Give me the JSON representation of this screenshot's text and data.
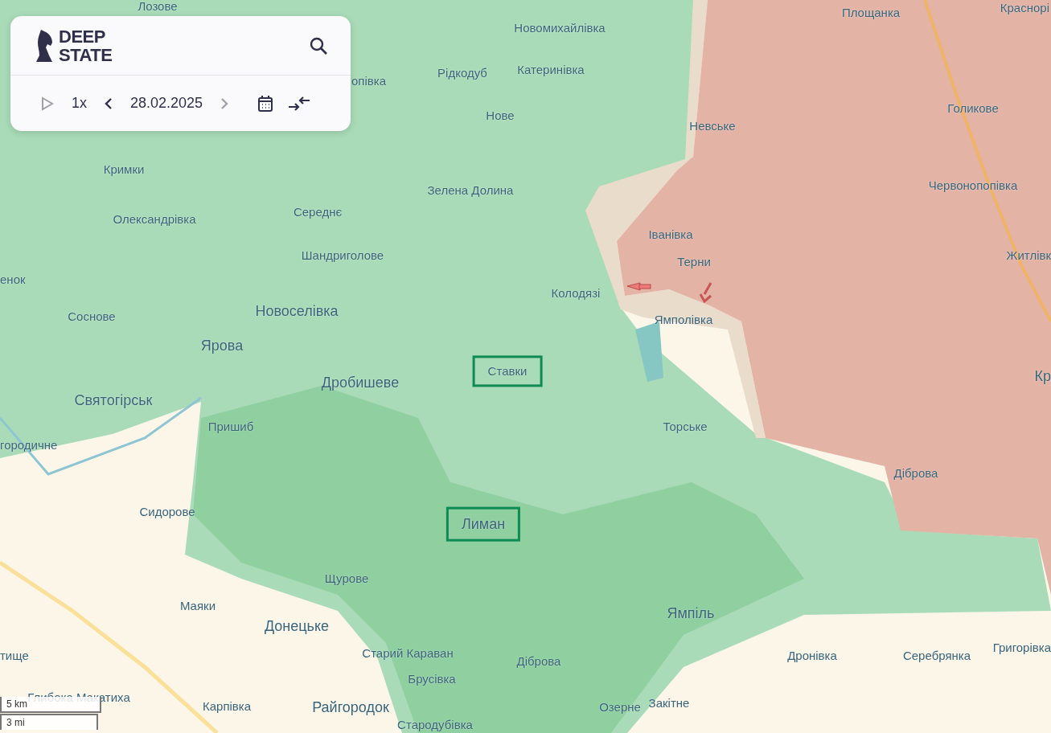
{
  "panel": {
    "logo": [
      "DEEP",
      "STATE"
    ],
    "play": {
      "disabled": true
    },
    "speed": "1x",
    "date": "28.02.2025",
    "prev": {
      "disabled": false
    },
    "next": {
      "disabled": true
    }
  },
  "labels": [
    {
      "text": "Лозове",
      "kind": "village",
      "highlighted": false
    },
    {
      "text": "Новомихайлівка",
      "kind": "village",
      "highlighted": false
    },
    {
      "text": "Площанка",
      "kind": "village",
      "highlighted": false
    },
    {
      "text": "Краснорі",
      "kind": "village",
      "highlighted": false
    },
    {
      "text": "Рідкодуб",
      "kind": "village",
      "highlighted": false
    },
    {
      "text": "Катеринівка",
      "kind": "village",
      "highlighted": false
    },
    {
      "text": "опівка",
      "kind": "village",
      "highlighted": false
    },
    {
      "text": "Нове",
      "kind": "village",
      "highlighted": false
    },
    {
      "text": "Невське",
      "kind": "village",
      "highlighted": false
    },
    {
      "text": "Голикове",
      "kind": "village",
      "highlighted": false
    },
    {
      "text": "Кримки",
      "kind": "village",
      "highlighted": false
    },
    {
      "text": "Зелена Долина",
      "kind": "village",
      "highlighted": false
    },
    {
      "text": "Червонопопівка",
      "kind": "village",
      "highlighted": false
    },
    {
      "text": "Олександрівка",
      "kind": "village",
      "highlighted": false
    },
    {
      "text": "Середнє",
      "kind": "village",
      "highlighted": false
    },
    {
      "text": "Іванівка",
      "kind": "village",
      "highlighted": false
    },
    {
      "text": "Терни",
      "kind": "village",
      "highlighted": false
    },
    {
      "text": "Шандриголове",
      "kind": "village",
      "highlighted": false
    },
    {
      "text": "Житлівк",
      "kind": "village",
      "highlighted": false
    },
    {
      "text": "енок",
      "kind": "village",
      "highlighted": false
    },
    {
      "text": "Колодязі",
      "kind": "village",
      "highlighted": false
    },
    {
      "text": "Соснове",
      "kind": "village",
      "highlighted": false
    },
    {
      "text": "Новоселівка",
      "kind": "town",
      "highlighted": false
    },
    {
      "text": "Ямполівка",
      "kind": "village",
      "highlighted": false
    },
    {
      "text": "Ярова",
      "kind": "town",
      "highlighted": false
    },
    {
      "text": "Ставки",
      "kind": "village",
      "highlighted": true
    },
    {
      "text": "Дробишеве",
      "kind": "town",
      "highlighted": false
    },
    {
      "text": "Кр",
      "kind": "town",
      "highlighted": false
    },
    {
      "text": "Святогірськ",
      "kind": "town",
      "highlighted": false
    },
    {
      "text": "Пришиб",
      "kind": "village",
      "highlighted": false
    },
    {
      "text": "Торське",
      "kind": "village",
      "highlighted": false
    },
    {
      "text": "городичне",
      "kind": "village",
      "highlighted": false
    },
    {
      "text": "Діброва",
      "kind": "village",
      "highlighted": false
    },
    {
      "text": "Сидорове",
      "kind": "village",
      "highlighted": false
    },
    {
      "text": "Лиман",
      "kind": "town",
      "highlighted": true
    },
    {
      "text": "Щурове",
      "kind": "village",
      "highlighted": false
    },
    {
      "text": "Маяки",
      "kind": "village",
      "highlighted": false
    },
    {
      "text": "Донецьке",
      "kind": "town",
      "highlighted": false
    },
    {
      "text": "Ямпіль",
      "kind": "town",
      "highlighted": false
    },
    {
      "text": "тище",
      "kind": "village",
      "highlighted": false
    },
    {
      "text": "Старий Караван",
      "kind": "village",
      "highlighted": false
    },
    {
      "text": "Діброва",
      "kind": "village",
      "highlighted": false
    },
    {
      "text": "Дронівка",
      "kind": "village",
      "highlighted": false
    },
    {
      "text": "Серебрянка",
      "kind": "village",
      "highlighted": false
    },
    {
      "text": "Григорівка",
      "kind": "village",
      "highlighted": false
    },
    {
      "text": "Брусівка",
      "kind": "village",
      "highlighted": false
    },
    {
      "text": "Глибока Макатиха",
      "kind": "village",
      "highlighted": false
    },
    {
      "text": "Карпівка",
      "kind": "village",
      "highlighted": false
    },
    {
      "text": "Райгородок",
      "kind": "town",
      "highlighted": false
    },
    {
      "text": "Озерне",
      "kind": "village",
      "highlighted": false
    },
    {
      "text": "Закітне",
      "kind": "village",
      "highlighted": false
    },
    {
      "text": "Стародубівка",
      "kind": "village",
      "highlighted": false
    }
  ],
  "scale": [
    "5 km",
    "3 mi"
  ]
}
